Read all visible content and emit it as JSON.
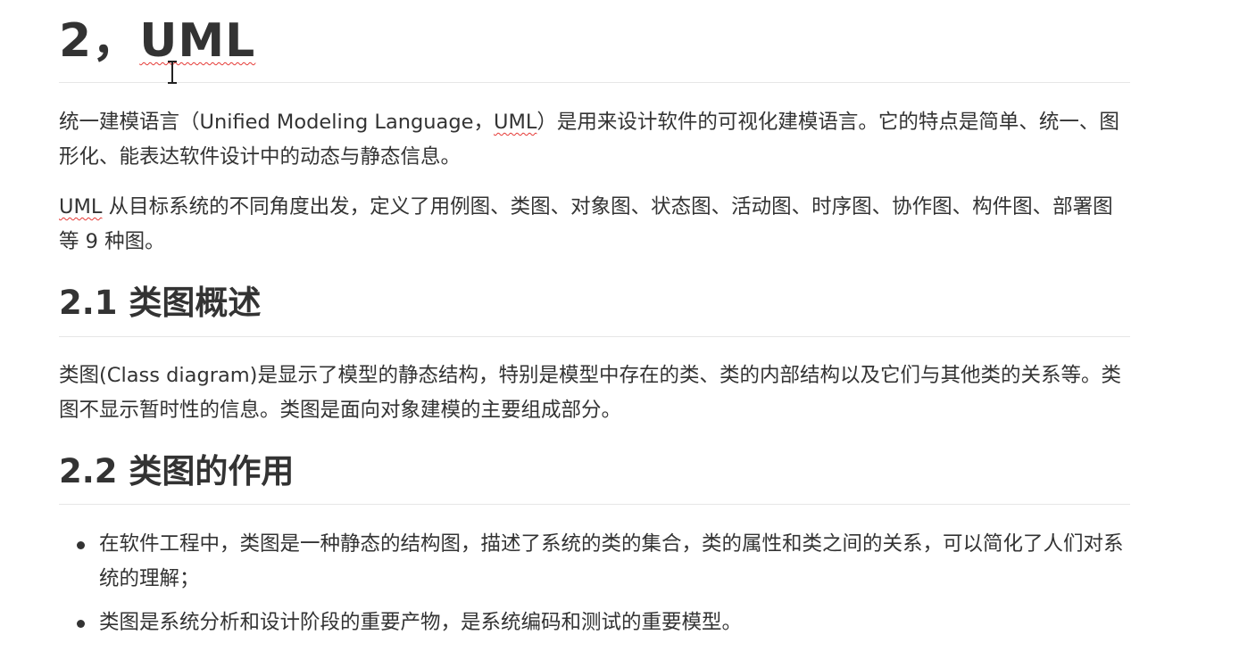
{
  "document": {
    "heading1": {
      "number": "2，",
      "term": "UML"
    },
    "intro_paragraph": {
      "before": "统一建模语言（Unified Modeling Language，",
      "term": "UML",
      "after": "）是用来设计软件的可视化建模语言。它的特点是简单、统一、图形化、能表达软件设计中的动态与静态信息。"
    },
    "diagrams_paragraph": {
      "term": "UML",
      "after": " 从目标系统的不同角度出发，定义了用例图、类图、对象图、状态图、活动图、时序图、协作图、构件图、部署图等 9 种图。"
    },
    "section_2_1": {
      "title": "2.1 类图概述",
      "paragraph": "类图(Class diagram)是显示了模型的静态结构，特别是模型中存在的类、类的内部结构以及它们与其他类的关系等。类图不显示暂时性的信息。类图是面向对象建模的主要组成部分。"
    },
    "section_2_2": {
      "title": "2.2 类图的作用",
      "bullets": [
        "在软件工程中，类图是一种静态的结构图，描述了系统的类的集合，类的属性和类之间的关系，可以简化了人们对系统的理解；",
        "类图是系统分析和设计阶段的重要产物，是系统编码和测试的重要模型。"
      ]
    }
  },
  "cursor": {
    "type": "text-ibeam-cursor"
  }
}
